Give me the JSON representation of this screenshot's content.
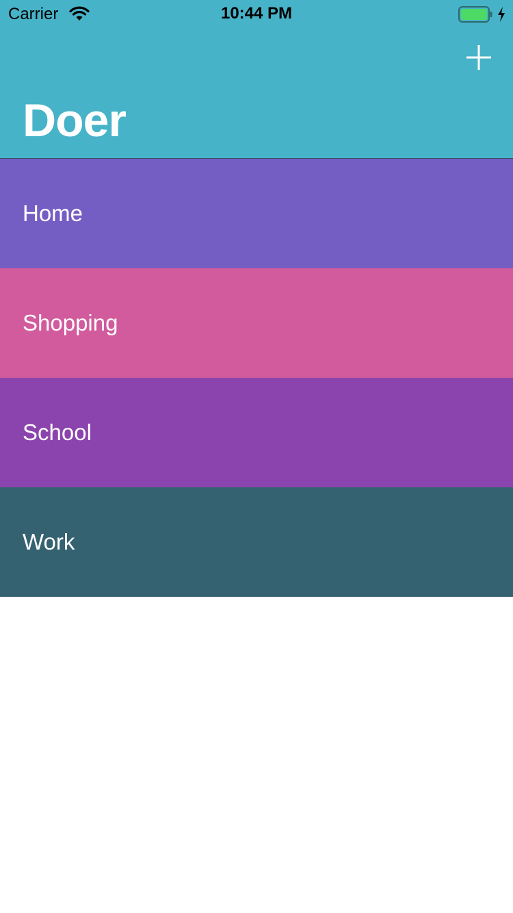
{
  "status_bar": {
    "carrier": "Carrier",
    "time": "10:44 PM",
    "battery_color": "#4cd964"
  },
  "header": {
    "title": "Doer",
    "background": "#47b3c8",
    "add_icon": "plus-icon"
  },
  "categories": [
    {
      "label": "Home",
      "color": "#755ec3"
    },
    {
      "label": "Shopping",
      "color": "#d15b9c"
    },
    {
      "label": "School",
      "color": "#8b44ad"
    },
    {
      "label": "Work",
      "color": "#356271"
    }
  ]
}
